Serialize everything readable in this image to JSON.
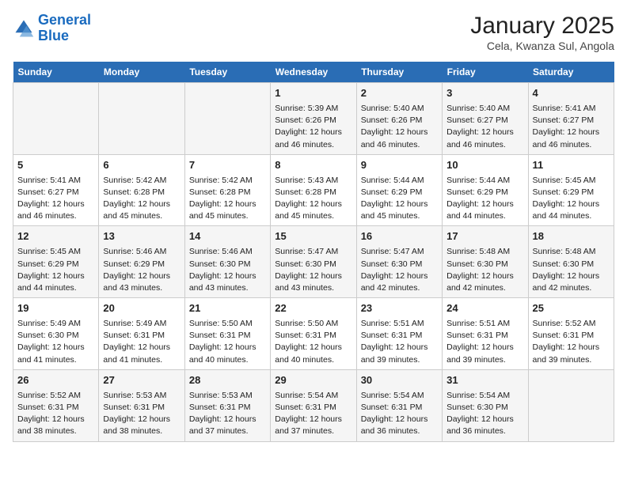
{
  "header": {
    "logo_line1": "General",
    "logo_line2": "Blue",
    "title": "January 2025",
    "subtitle": "Cela, Kwanza Sul, Angola"
  },
  "days_of_week": [
    "Sunday",
    "Monday",
    "Tuesday",
    "Wednesday",
    "Thursday",
    "Friday",
    "Saturday"
  ],
  "weeks": [
    [
      {
        "day": "",
        "info": ""
      },
      {
        "day": "",
        "info": ""
      },
      {
        "day": "",
        "info": ""
      },
      {
        "day": "1",
        "info": "Sunrise: 5:39 AM\nSunset: 6:26 PM\nDaylight: 12 hours\nand 46 minutes."
      },
      {
        "day": "2",
        "info": "Sunrise: 5:40 AM\nSunset: 6:26 PM\nDaylight: 12 hours\nand 46 minutes."
      },
      {
        "day": "3",
        "info": "Sunrise: 5:40 AM\nSunset: 6:27 PM\nDaylight: 12 hours\nand 46 minutes."
      },
      {
        "day": "4",
        "info": "Sunrise: 5:41 AM\nSunset: 6:27 PM\nDaylight: 12 hours\nand 46 minutes."
      }
    ],
    [
      {
        "day": "5",
        "info": "Sunrise: 5:41 AM\nSunset: 6:27 PM\nDaylight: 12 hours\nand 46 minutes."
      },
      {
        "day": "6",
        "info": "Sunrise: 5:42 AM\nSunset: 6:28 PM\nDaylight: 12 hours\nand 45 minutes."
      },
      {
        "day": "7",
        "info": "Sunrise: 5:42 AM\nSunset: 6:28 PM\nDaylight: 12 hours\nand 45 minutes."
      },
      {
        "day": "8",
        "info": "Sunrise: 5:43 AM\nSunset: 6:28 PM\nDaylight: 12 hours\nand 45 minutes."
      },
      {
        "day": "9",
        "info": "Sunrise: 5:44 AM\nSunset: 6:29 PM\nDaylight: 12 hours\nand 45 minutes."
      },
      {
        "day": "10",
        "info": "Sunrise: 5:44 AM\nSunset: 6:29 PM\nDaylight: 12 hours\nand 44 minutes."
      },
      {
        "day": "11",
        "info": "Sunrise: 5:45 AM\nSunset: 6:29 PM\nDaylight: 12 hours\nand 44 minutes."
      }
    ],
    [
      {
        "day": "12",
        "info": "Sunrise: 5:45 AM\nSunset: 6:29 PM\nDaylight: 12 hours\nand 44 minutes."
      },
      {
        "day": "13",
        "info": "Sunrise: 5:46 AM\nSunset: 6:29 PM\nDaylight: 12 hours\nand 43 minutes."
      },
      {
        "day": "14",
        "info": "Sunrise: 5:46 AM\nSunset: 6:30 PM\nDaylight: 12 hours\nand 43 minutes."
      },
      {
        "day": "15",
        "info": "Sunrise: 5:47 AM\nSunset: 6:30 PM\nDaylight: 12 hours\nand 43 minutes."
      },
      {
        "day": "16",
        "info": "Sunrise: 5:47 AM\nSunset: 6:30 PM\nDaylight: 12 hours\nand 42 minutes."
      },
      {
        "day": "17",
        "info": "Sunrise: 5:48 AM\nSunset: 6:30 PM\nDaylight: 12 hours\nand 42 minutes."
      },
      {
        "day": "18",
        "info": "Sunrise: 5:48 AM\nSunset: 6:30 PM\nDaylight: 12 hours\nand 42 minutes."
      }
    ],
    [
      {
        "day": "19",
        "info": "Sunrise: 5:49 AM\nSunset: 6:30 PM\nDaylight: 12 hours\nand 41 minutes."
      },
      {
        "day": "20",
        "info": "Sunrise: 5:49 AM\nSunset: 6:31 PM\nDaylight: 12 hours\nand 41 minutes."
      },
      {
        "day": "21",
        "info": "Sunrise: 5:50 AM\nSunset: 6:31 PM\nDaylight: 12 hours\nand 40 minutes."
      },
      {
        "day": "22",
        "info": "Sunrise: 5:50 AM\nSunset: 6:31 PM\nDaylight: 12 hours\nand 40 minutes."
      },
      {
        "day": "23",
        "info": "Sunrise: 5:51 AM\nSunset: 6:31 PM\nDaylight: 12 hours\nand 39 minutes."
      },
      {
        "day": "24",
        "info": "Sunrise: 5:51 AM\nSunset: 6:31 PM\nDaylight: 12 hours\nand 39 minutes."
      },
      {
        "day": "25",
        "info": "Sunrise: 5:52 AM\nSunset: 6:31 PM\nDaylight: 12 hours\nand 39 minutes."
      }
    ],
    [
      {
        "day": "26",
        "info": "Sunrise: 5:52 AM\nSunset: 6:31 PM\nDaylight: 12 hours\nand 38 minutes."
      },
      {
        "day": "27",
        "info": "Sunrise: 5:53 AM\nSunset: 6:31 PM\nDaylight: 12 hours\nand 38 minutes."
      },
      {
        "day": "28",
        "info": "Sunrise: 5:53 AM\nSunset: 6:31 PM\nDaylight: 12 hours\nand 37 minutes."
      },
      {
        "day": "29",
        "info": "Sunrise: 5:54 AM\nSunset: 6:31 PM\nDaylight: 12 hours\nand 37 minutes."
      },
      {
        "day": "30",
        "info": "Sunrise: 5:54 AM\nSunset: 6:31 PM\nDaylight: 12 hours\nand 36 minutes."
      },
      {
        "day": "31",
        "info": "Sunrise: 5:54 AM\nSunset: 6:30 PM\nDaylight: 12 hours\nand 36 minutes."
      },
      {
        "day": "",
        "info": ""
      }
    ]
  ]
}
